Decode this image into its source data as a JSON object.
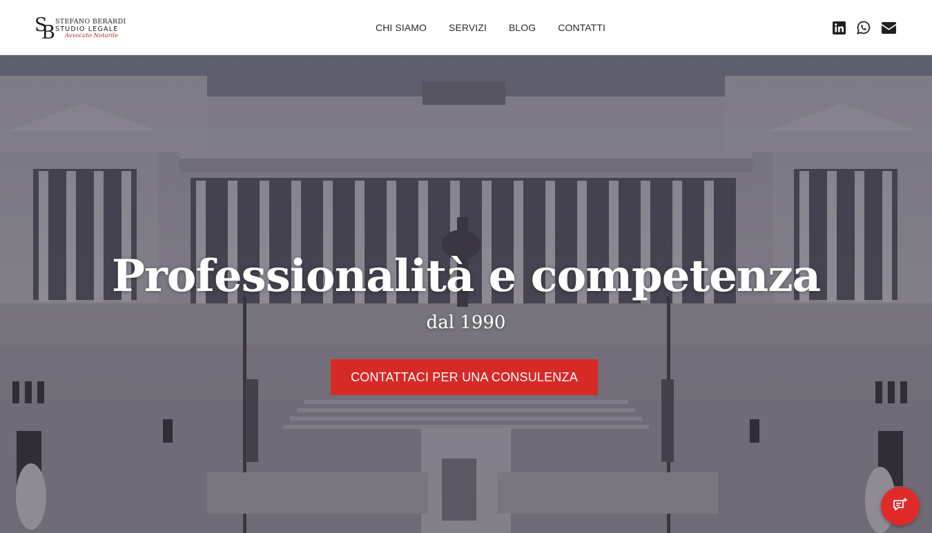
{
  "logo": {
    "monogram_s": "S",
    "monogram_b": "B",
    "line1": "STEFANO BERARDI",
    "line2": "STUDIO LEGALE",
    "line3": "Avvocato Notarile"
  },
  "nav": {
    "items": [
      {
        "label": "CHI SIAMO"
      },
      {
        "label": "SERVIZI"
      },
      {
        "label": "BLOG"
      },
      {
        "label": "CONTATTI"
      }
    ]
  },
  "social": {
    "icons": [
      "linkedin-icon",
      "whatsapp-icon",
      "email-icon"
    ]
  },
  "hero": {
    "title": "Professionalità e competenza",
    "subtitle": "dal 1990",
    "cta_label": "CONTATTACI PER UNA CONSULENZA"
  },
  "chat": {
    "icon": "chat-icon"
  },
  "colors": {
    "accent": "#d72a27",
    "logo_accent": "#b3282d",
    "text_dark": "#2a2a2a"
  }
}
